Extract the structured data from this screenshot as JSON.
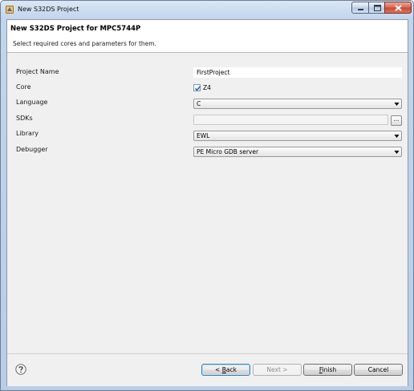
{
  "window": {
    "title": "New S32DS Project"
  },
  "header": {
    "title": "New S32DS Project for MPC5744P",
    "description": "Select required cores and parameters for them."
  },
  "form": {
    "project_name": {
      "label": "Project Name",
      "value": "FirstProject"
    },
    "core": {
      "label": "Core",
      "option": "Z4",
      "checked": true
    },
    "language": {
      "label": "Language",
      "value": "C"
    },
    "sdks": {
      "label": "SDKs",
      "value": "",
      "browse_label": "..."
    },
    "library": {
      "label": "Library",
      "value": "EWL"
    },
    "debugger": {
      "label": "Debugger",
      "value": "PE Micro GDB server"
    }
  },
  "footer": {
    "help_icon": "question-mark-icon",
    "back_prefix": "< ",
    "back_mnemonic": "B",
    "back_rest": "ack",
    "next_label": "Next >",
    "finish_mnemonic": "F",
    "finish_rest": "inish",
    "cancel_label": "Cancel"
  },
  "colors": {
    "titlebar": "#c2d5ec",
    "dialog_bg": "#f0f0f0",
    "close_button": "#c7472d"
  }
}
